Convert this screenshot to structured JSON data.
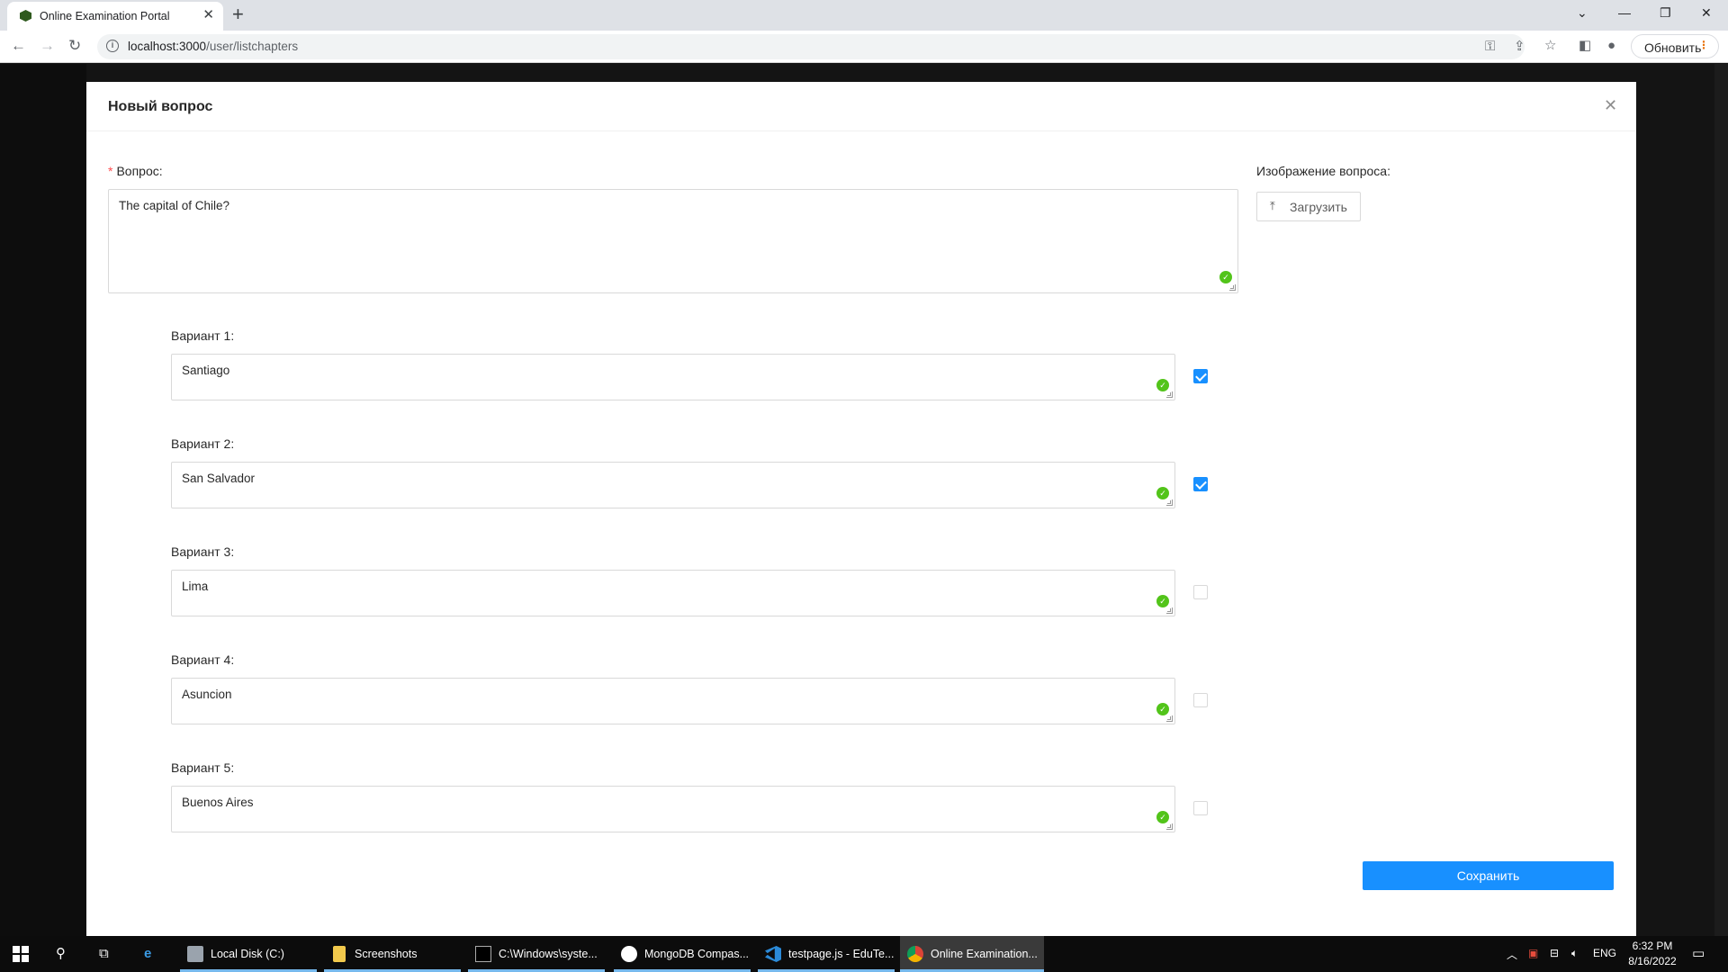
{
  "browser": {
    "tab_title": "Online Examination Portal",
    "new_tab": "+",
    "url_host": "localhost:3000",
    "url_path": "/user/listchapters",
    "update_button": "Обновить"
  },
  "modal": {
    "title": "Новый вопрос",
    "question_label": "Вопрос",
    "question_value": "The capital of Chile?",
    "image_label": "Изображение вопроса",
    "upload_label": "Загрузить",
    "options": [
      {
        "label": "Вариант 1",
        "value": "Santiago",
        "checked": true
      },
      {
        "label": "Вариант 2",
        "value": "San Salvador",
        "checked": true
      },
      {
        "label": "Вариант 3",
        "value": "Lima",
        "checked": false
      },
      {
        "label": "Вариант 4",
        "value": "Asuncion",
        "checked": false
      },
      {
        "label": "Вариант 5",
        "value": "Buenos Aires",
        "checked": false
      }
    ],
    "save_label": "Сохранить"
  },
  "taskbar": {
    "items": [
      {
        "label": "Local Disk (C:)",
        "icon": "drive-icon"
      },
      {
        "label": "Screenshots",
        "icon": "folder-icon"
      },
      {
        "label": "C:\\Windows\\syste...",
        "icon": "terminal-icon"
      },
      {
        "label": "MongoDB Compas...",
        "icon": "mongodb-icon"
      },
      {
        "label": "testpage.js - EduTe...",
        "icon": "vscode-icon"
      },
      {
        "label": "Online Examination...",
        "icon": "chrome-icon"
      }
    ],
    "language": "ENG",
    "time": "6:32 PM",
    "date": "8/16/2022"
  },
  "colors": {
    "primary": "#1890ff",
    "success": "#52c41a",
    "required": "#ff4d4f"
  }
}
